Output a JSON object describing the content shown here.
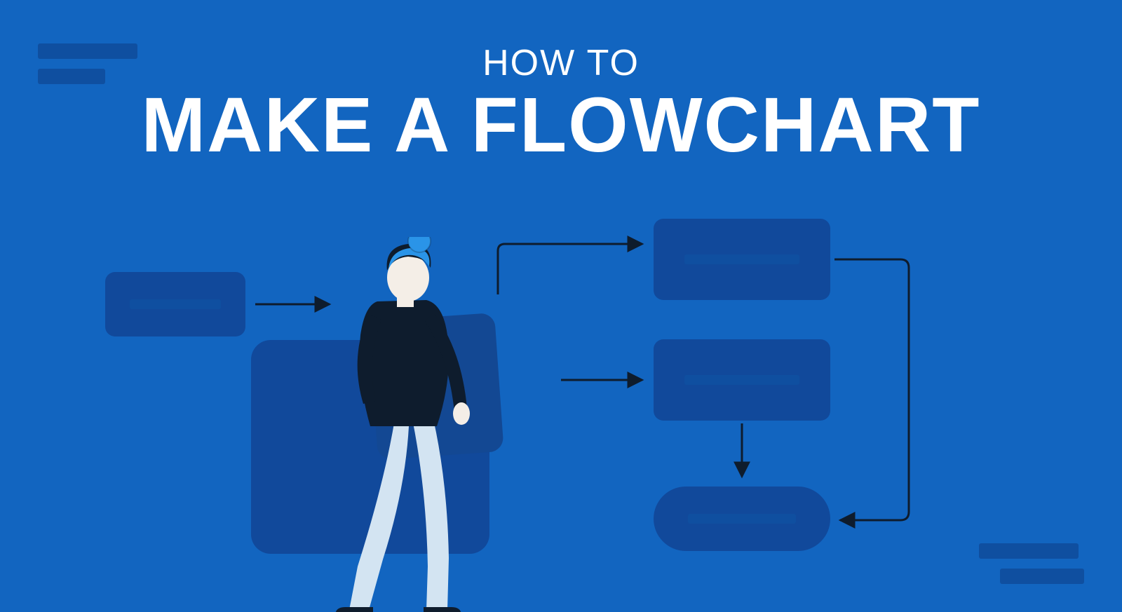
{
  "title": {
    "overline": "HOW TO",
    "main": "MAKE A FLOWCHART"
  },
  "colors": {
    "background": "#1265c0",
    "node_fill": "#11499b",
    "accent_dark": "#0f4fa0",
    "text": "#ffffff",
    "person_shirt": "#0e1c2d",
    "person_hair": "#2a94e8",
    "person_skin": "#f4eee7",
    "person_pants": "#d3e4f2"
  },
  "flow": {
    "nodes": [
      {
        "id": "start",
        "shape": "rect",
        "label_placeholder": true
      },
      {
        "id": "step1",
        "shape": "rect",
        "label_placeholder": true
      },
      {
        "id": "step2",
        "shape": "rect",
        "label_placeholder": true
      },
      {
        "id": "end",
        "shape": "terminator",
        "label_placeholder": true
      }
    ],
    "edges": [
      {
        "from": "start",
        "to": "person"
      },
      {
        "from": "person",
        "to": "step1"
      },
      {
        "from": "person",
        "to": "step2"
      },
      {
        "from": "step2",
        "to": "end"
      },
      {
        "from": "step1",
        "to": "end"
      }
    ]
  }
}
